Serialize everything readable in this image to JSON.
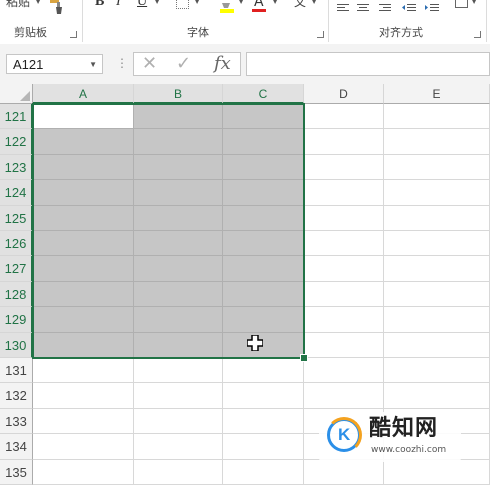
{
  "ribbon": {
    "paste_label": "粘贴",
    "bold_label": "B",
    "italic_label": "I",
    "underline_label": "U",
    "font_color_label": "A",
    "wrap_label": "文",
    "groups": [
      {
        "label": "剪贴板"
      },
      {
        "label": "字体"
      },
      {
        "label": "对齐方式"
      }
    ]
  },
  "formula_bar": {
    "name_box": "A121",
    "cancel_icon": "✕",
    "enter_icon": "✓",
    "fx_label": "fx",
    "formula_value": ""
  },
  "columns": [
    {
      "label": "A",
      "selected": true
    },
    {
      "label": "B",
      "selected": true
    },
    {
      "label": "C",
      "selected": true
    },
    {
      "label": "D",
      "selected": false
    },
    {
      "label": "E",
      "selected": false
    }
  ],
  "rows": [
    {
      "label": "121",
      "selected": true
    },
    {
      "label": "122",
      "selected": true
    },
    {
      "label": "123",
      "selected": true
    },
    {
      "label": "124",
      "selected": true
    },
    {
      "label": "125",
      "selected": true
    },
    {
      "label": "126",
      "selected": true
    },
    {
      "label": "127",
      "selected": true
    },
    {
      "label": "128",
      "selected": true
    },
    {
      "label": "129",
      "selected": true
    },
    {
      "label": "130",
      "selected": true
    },
    {
      "label": "131",
      "selected": false
    },
    {
      "label": "132",
      "selected": false
    },
    {
      "label": "133",
      "selected": false
    },
    {
      "label": "134",
      "selected": false
    },
    {
      "label": "135",
      "selected": false
    }
  ],
  "selection": {
    "range": "A121:C130",
    "active_cell": "A121"
  },
  "watermark": {
    "title": "酷知网",
    "url": "www.coozhi.com",
    "logo_letter": "K"
  },
  "colors": {
    "accent": "#217346",
    "selection_fill": "#c6c6c6",
    "header_bg": "#f3f3f3"
  },
  "icons": [
    "format-painter-icon",
    "border-icon",
    "fill-color-icon",
    "align-left-icon",
    "align-center-icon",
    "align-right-icon",
    "indent-icon",
    "merge-icon",
    "cross-cursor-icon"
  ]
}
